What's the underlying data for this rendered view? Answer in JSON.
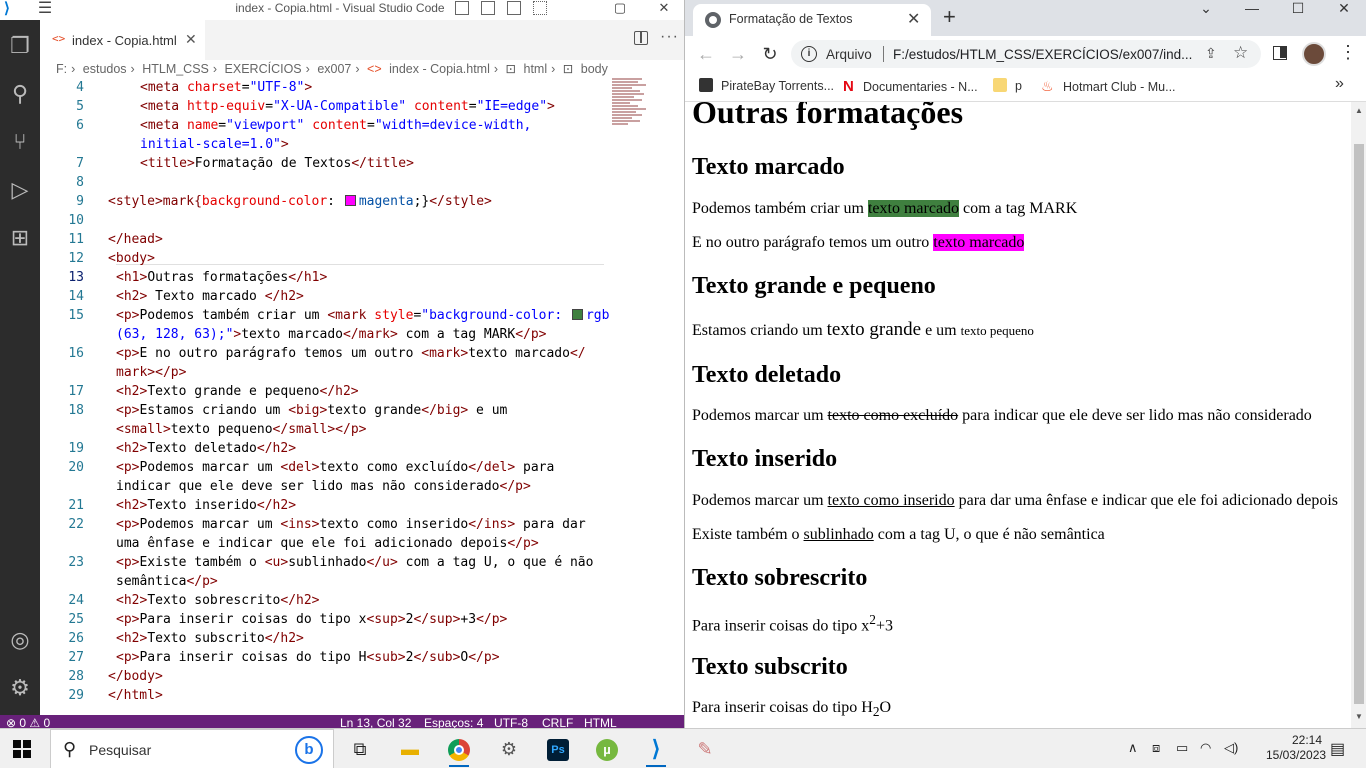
{
  "vscode": {
    "window_title": "index - Copia.html - Visual Studio Code",
    "tab_label": "index - Copia.html",
    "breadcrumb": [
      "F:",
      "estudos",
      "HTLM_CSS",
      "EXERCÍCIOS",
      "ex007",
      "index - Copia.html",
      "html",
      "body"
    ],
    "status": {
      "errors": "⊗ 0 ⚠ 0",
      "position": "Ln 13, Col 32",
      "spaces": "Espaços: 4",
      "encoding": "UTF-8",
      "eol": "CRLF",
      "language": "HTML"
    },
    "line_numbers": [
      "4",
      "5",
      "6",
      "",
      "7",
      "8",
      "9",
      "10",
      "11",
      "12",
      "13",
      "14",
      "15",
      "",
      "16",
      "",
      "17",
      "18",
      "",
      "19",
      "20",
      "",
      "21",
      "22",
      "",
      "23",
      "",
      "24",
      "25",
      "26",
      "27",
      "28",
      "29"
    ]
  },
  "chrome": {
    "tab_title": "Formatação de Textos",
    "omnibox_label": "Arquivo",
    "url": "F:/estudos/HTLM_CSS/EXERCÍCIOS/ex007/ind...",
    "bookmarks": [
      "PirateBay Torrents...",
      "Documentaries - N...",
      "p",
      "Hotmart Club - Mu..."
    ]
  },
  "page": {
    "h1": "Outras formatações",
    "h2_marcado": "Texto marcado",
    "p1_a": "Podemos também criar um ",
    "p1_mark": "texto marcado",
    "p1_b": " com a tag MARK",
    "p2_a": "E no outro parágrafo temos um outro ",
    "p2_mark": "texto marcado",
    "h2_grande": "Texto grande e pequeno",
    "p3_a": "Estamos criando um ",
    "p3_big": "texto grande",
    "p3_b": " e um ",
    "p3_small": "texto pequeno",
    "h2_deletado": "Texto deletado",
    "p4_a": "Podemos marcar um ",
    "p4_del": "texto como excluído",
    "p4_b": " para indicar que ele deve ser lido mas não considerado",
    "h2_inserido": "Texto inserido",
    "p5_a": "Podemos marcar um ",
    "p5_ins": "texto como inserido",
    "p5_b": " para dar uma ênfase e indicar que ele foi adicionado depois",
    "p6_a": "Existe também o ",
    "p6_u": "sublinhado",
    "p6_b": " com a tag U, o que é não semântica",
    "h2_sobrescrito": "Texto sobrescrito",
    "p7_a": "Para inserir coisas do tipo x",
    "p7_sup": "2",
    "p7_b": "+3",
    "h2_subscrito": "Texto subscrito",
    "p8_a": "Para inserir coisas do tipo H",
    "p8_sub": "2",
    "p8_b": "O"
  },
  "taskbar": {
    "search_placeholder": "Pesquisar",
    "time": "22:14",
    "date": "15/03/2023"
  },
  "colors": {
    "mark_green": "#3f803f",
    "mark_magenta": "#ff00ff",
    "vscode_status": "#68217a"
  }
}
